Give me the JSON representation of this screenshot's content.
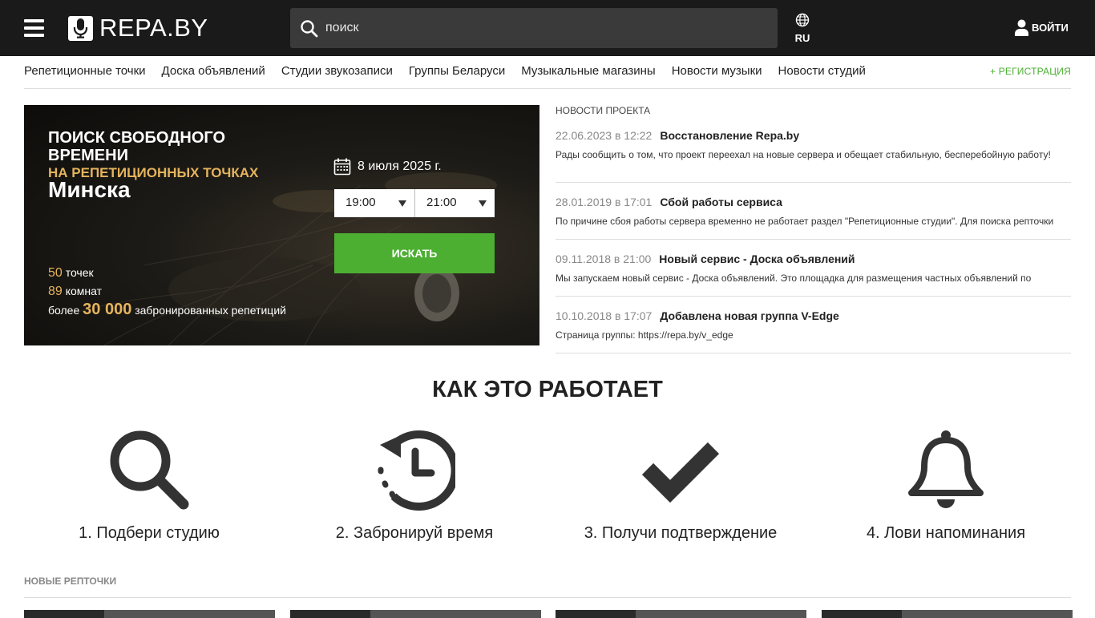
{
  "header": {
    "logo_text": "REPA.BY",
    "search_placeholder": "поиск",
    "lang": "RU",
    "login": "ВОЙТИ"
  },
  "nav": {
    "links": [
      "Репетиционные точки",
      "Доска объявлений",
      "Студии звукозаписи",
      "Группы Беларуси",
      "Музыкальные магазины",
      "Новости музыки",
      "Новости студий"
    ],
    "register": "+ РЕГИСТРАЦИЯ"
  },
  "hero": {
    "title_line1": "ПОИСК СВОБОДНОГО ВРЕМЕНИ",
    "title_line2": "НА РЕПЕТИЦИОННЫХ ТОЧКАХ",
    "title_city": "Минска",
    "date": "8 июля 2025 г.",
    "time_from": "19:00",
    "time_to": "21:00",
    "search_button": "ИСКАТЬ",
    "stats": {
      "points_num": "50",
      "points_label": "точек",
      "rooms_num": "89",
      "rooms_label": "комнат",
      "booked_prefix": "более",
      "booked_num": "30 000",
      "booked_label": "забронированных репетиций"
    }
  },
  "news": {
    "heading": "НОВОСТИ ПРОЕКТА",
    "items": [
      {
        "date": "22.06.2023 в 12:22",
        "title": "Восстановление Repa.by",
        "text": "Рады сообщить о том, что проект переехал на новые сервера и обещает стабильную, бесперебойную работу!"
      },
      {
        "date": "28.01.2019 в 17:01",
        "title": "Сбой работы сервиса",
        "text": "По причине сбоя работы сервера временно не работает раздел \"Репетиционные студии\". Для поиска репточки"
      },
      {
        "date": "09.11.2018 в 21:00",
        "title": "Новый сервис - Доска объявлений",
        "text": "Мы запускаем новый сервис - Доска объявлений. Это площадка для размещения частных объявлений по"
      },
      {
        "date": "10.10.2018 в 17:07",
        "title": "Добавлена новая группа V-Edge",
        "text": "Страница группы: https://repa.by/v_edge"
      }
    ]
  },
  "how": {
    "title": "КАК ЭТО РАБОТАЕТ",
    "steps": [
      {
        "label": "1. Подбери студию",
        "icon": "search-icon"
      },
      {
        "label": "2. Забронируй время",
        "icon": "history-clock-icon"
      },
      {
        "label": "3. Получи подтверждение",
        "icon": "checkmark-icon"
      },
      {
        "label": "4. Лови напоминания",
        "icon": "bell-icon"
      }
    ]
  },
  "new_points": {
    "heading": "НОВЫЕ РЕПТОЧКИ"
  },
  "colors": {
    "header_bg": "#1a1a1a",
    "accent_green": "#4caf32",
    "accent_gold": "#e5b45c"
  }
}
